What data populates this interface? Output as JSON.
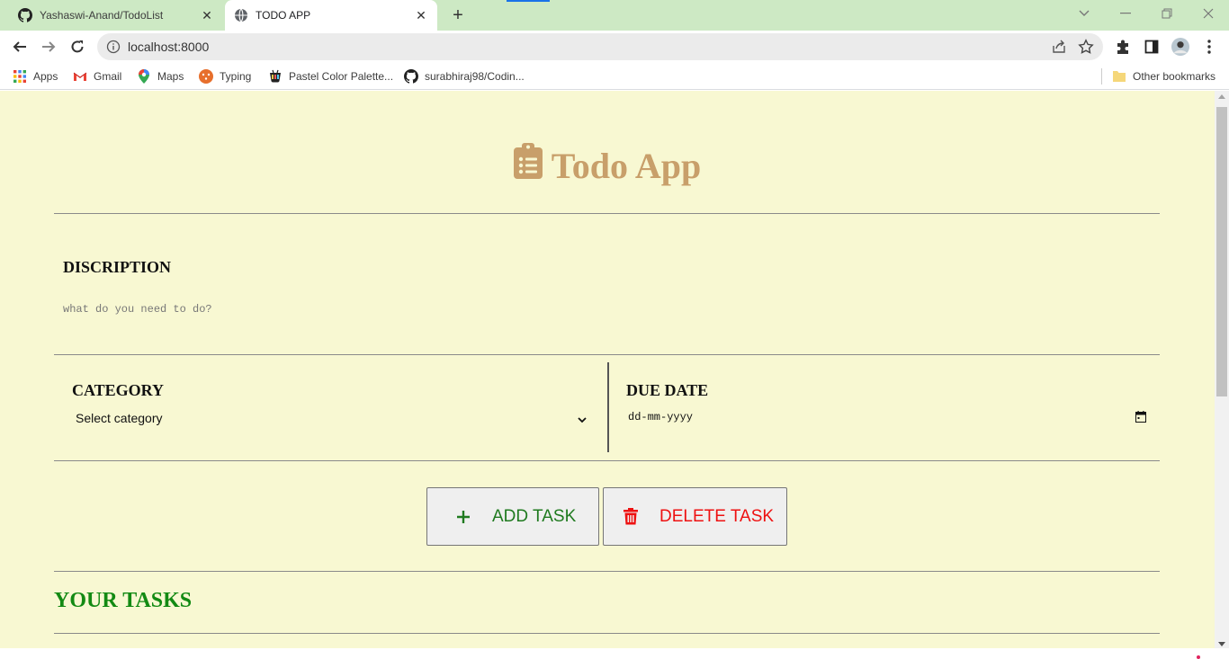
{
  "browser": {
    "tabs": [
      {
        "title": "Yashaswi-Anand/TodoList",
        "active": false,
        "icon": "github-icon"
      },
      {
        "title": "TODO APP",
        "active": true,
        "icon": "globe-icon"
      }
    ],
    "url": "localhost:8000",
    "bookmarks": [
      {
        "label": "Apps",
        "icon": "apps-grid-icon"
      },
      {
        "label": "Gmail",
        "icon": "gmail-icon"
      },
      {
        "label": "Maps",
        "icon": "maps-pin-icon"
      },
      {
        "label": "Typing",
        "icon": "typing-icon"
      },
      {
        "label": "Pastel Color Palette...",
        "icon": "palette-icon"
      },
      {
        "label": "surabhiraj98/Codin...",
        "icon": "github-icon"
      }
    ],
    "other_bookmarks": "Other bookmarks"
  },
  "app": {
    "title": "Todo App",
    "description_label": "DISCRIPTION",
    "description_placeholder": "what do you need to do?",
    "category_label": "CATEGORY",
    "category_selected": "Select category",
    "due_date_label": "DUE DATE",
    "due_date_placeholder": "dd-mm-yyyy",
    "add_button": "ADD TASK",
    "delete_button": "DELETE TASK",
    "tasks_heading": "YOUR TASKS"
  },
  "colors": {
    "page_bg": "#f8f8d2",
    "title": "#c89f6a",
    "add": "#1f7a1f",
    "delete": "#ee1111",
    "tasks_heading": "#138a13",
    "tabstrip": "#cde9c4"
  }
}
